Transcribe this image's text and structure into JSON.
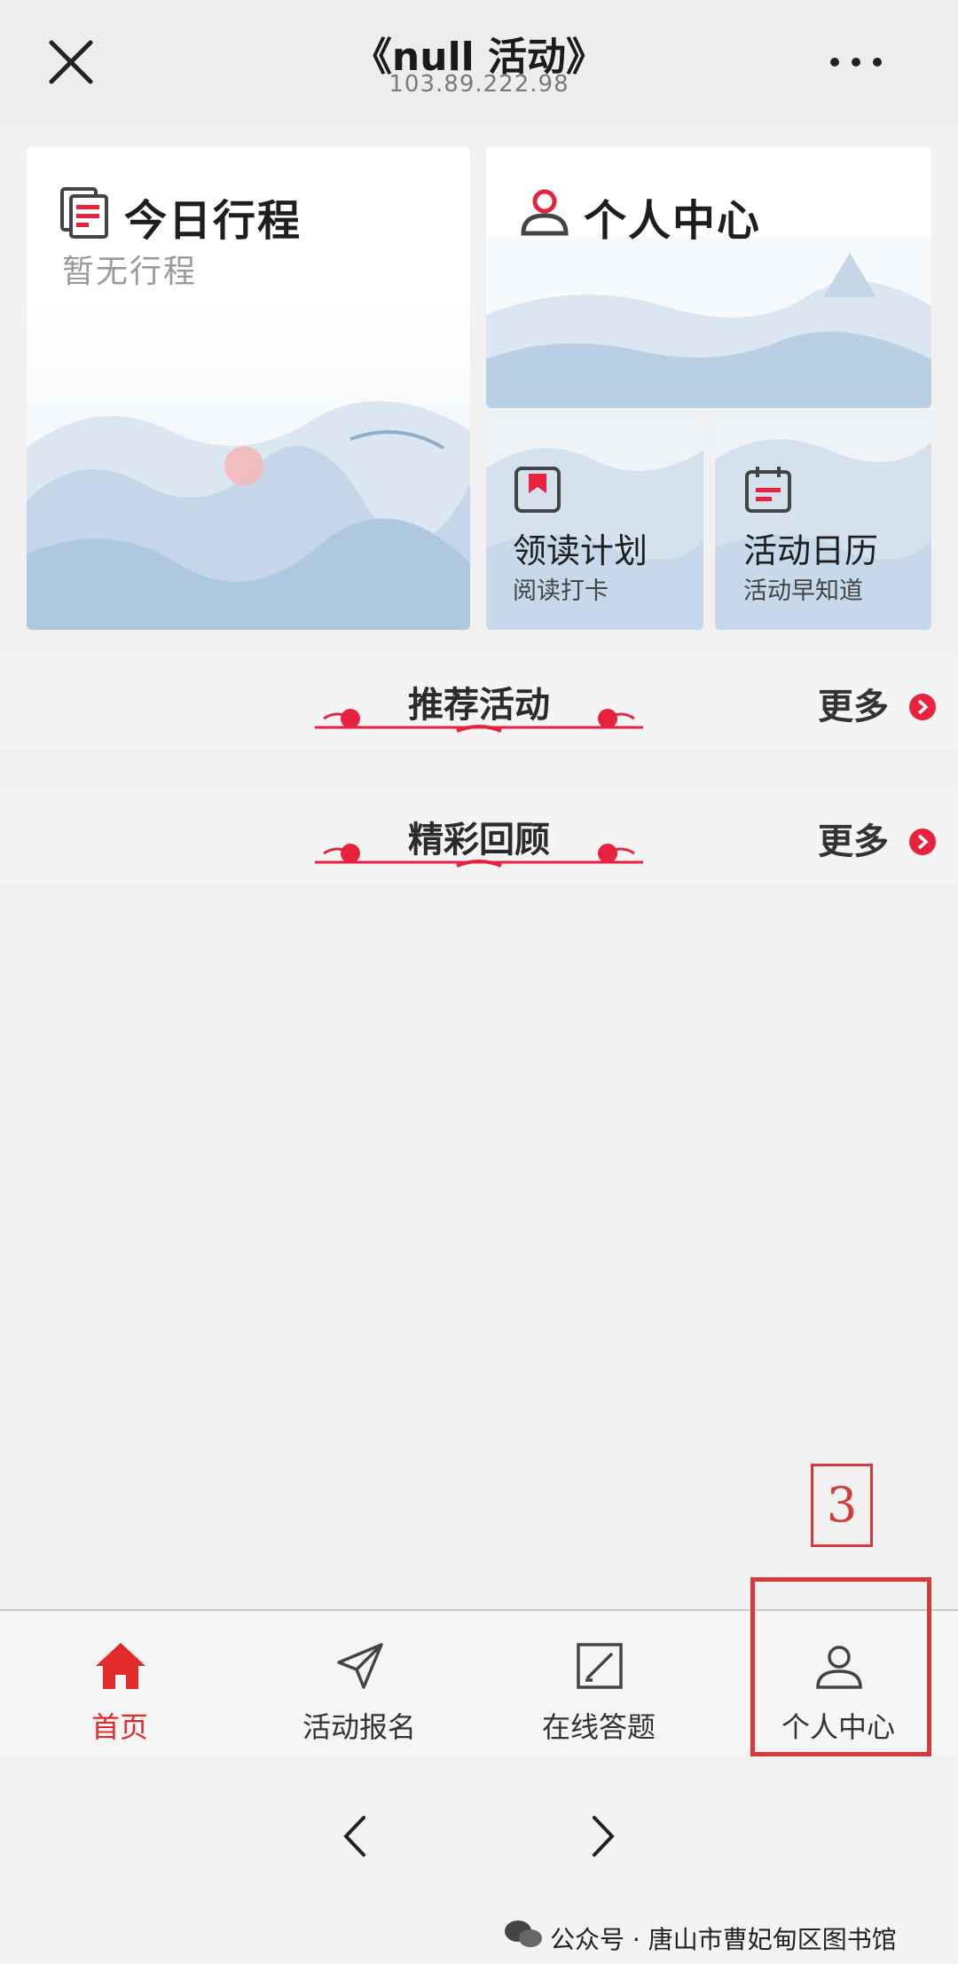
{
  "header": {
    "title": "《null 活动》",
    "subtitle": "103.89.222.98"
  },
  "cards": {
    "today": {
      "title": "今日行程",
      "subtitle": "暂无行程"
    },
    "personal": {
      "title": "个人中心"
    },
    "reading": {
      "title": "领读计划",
      "subtitle": "阅读打卡"
    },
    "calendar": {
      "title": "活动日历",
      "subtitle": "活动早知道"
    }
  },
  "sections": [
    {
      "title": "推荐活动",
      "more": "更多"
    },
    {
      "title": "精彩回顾",
      "more": "更多"
    }
  ],
  "nav": {
    "items": [
      {
        "label": "首页",
        "active": true
      },
      {
        "label": "活动报名",
        "active": false
      },
      {
        "label": "在线答题",
        "active": false
      },
      {
        "label": "个人中心",
        "active": false
      }
    ]
  },
  "annotation": {
    "number": "3"
  },
  "watermark": {
    "text": "公众号 · 唐山市曹妃甸区图书馆"
  },
  "colors": {
    "accent": "#e8223d",
    "annotation": "#d63a3a",
    "active_nav": "#e32a2a"
  }
}
